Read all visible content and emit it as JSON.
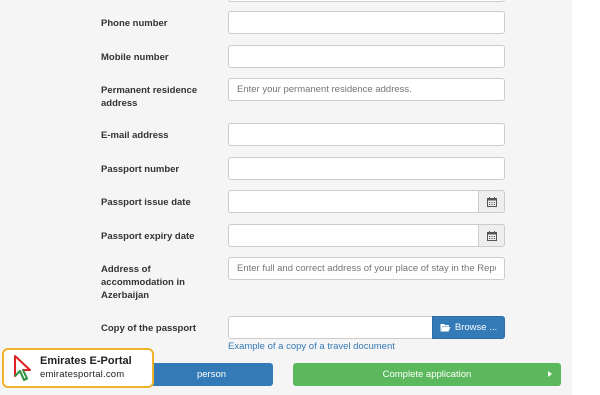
{
  "form": {
    "fields": [
      {
        "label": "Phone number",
        "value": "",
        "placeholder": ""
      },
      {
        "label": "Mobile number",
        "value": "",
        "placeholder": ""
      },
      {
        "label": "Permanent residence address",
        "value": "",
        "placeholder": "Enter your permanent residence address."
      },
      {
        "label": "E-mail address",
        "value": "",
        "placeholder": ""
      },
      {
        "label": "Passport number",
        "value": "",
        "placeholder": ""
      },
      {
        "label": "Passport issue date",
        "value": "",
        "placeholder": "",
        "icon": "calendar-icon"
      },
      {
        "label": "Passport expiry date",
        "value": "",
        "placeholder": "",
        "icon": "calendar-icon"
      },
      {
        "label": "Address of accommodation in Azerbaijan",
        "value": "",
        "placeholder": "Enter full and correct address of your place of stay in the Repu"
      },
      {
        "label": "Copy of the passport",
        "value": ""
      }
    ],
    "browse_label": "Browse ...",
    "example_link": "Example of a copy of a travel document"
  },
  "actions": {
    "add_person_label": "person",
    "complete_label": "Complete application"
  },
  "watermark": {
    "title": "Emirates E-Portal",
    "url": "emiratesportal.com"
  },
  "colors": {
    "primary": "#337ab7",
    "success": "#5cb85c",
    "logo_border": "#f0b429"
  }
}
